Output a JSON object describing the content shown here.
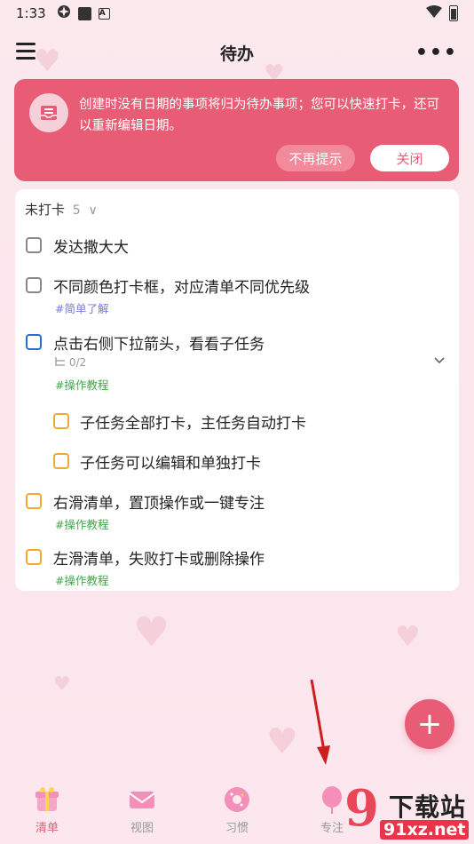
{
  "status_bar": {
    "time": "1:33"
  },
  "header": {
    "title": "待办",
    "more": "•••"
  },
  "banner": {
    "text": "创建时没有日期的事项将归为待办事项；您可以快速打卡，还可以重新编辑日期。",
    "dismiss_label": "不再提示",
    "close_label": "关闭"
  },
  "section": {
    "title": "未打卡",
    "count": "5",
    "chevron": "∨"
  },
  "tasks": [
    {
      "title": "发达撒大大",
      "checkbox_color": "#888888"
    },
    {
      "title": "不同颜色打卡框，对应清单不同优先级",
      "tag": "#简单了解",
      "checkbox_color": "#888888"
    },
    {
      "title": "点击右侧下拉箭头，看看子任务",
      "subtask_count": "0/2",
      "tag": "#操作教程",
      "checkbox_color": "#2b6bd8"
    },
    {
      "title": "右滑清单，置顶操作或一键专注",
      "tag": "#操作教程",
      "checkbox_color": "#f0a830"
    },
    {
      "title": "左滑清单，失败打卡或删除操作",
      "tag": "#操作教程",
      "checkbox_color": "#f0a830"
    }
  ],
  "subtasks": [
    {
      "title": "子任务全部打卡，主任务自动打卡"
    },
    {
      "title": "子任务可以编辑和单独打卡"
    }
  ],
  "fab": {
    "label": "+"
  },
  "nav": [
    {
      "label": "清单",
      "active": true
    },
    {
      "label": "视图",
      "active": false
    },
    {
      "label": "习惯",
      "active": false
    },
    {
      "label": "专注",
      "active": false
    }
  ],
  "watermark": {
    "big": "9",
    "title": "下载站",
    "url": "91xz.net"
  },
  "colors": {
    "accent": "#e85d75",
    "tag_purple": "#7b77d8",
    "tag_green": "#3fa84a",
    "arrow": "#cc1f1f"
  }
}
